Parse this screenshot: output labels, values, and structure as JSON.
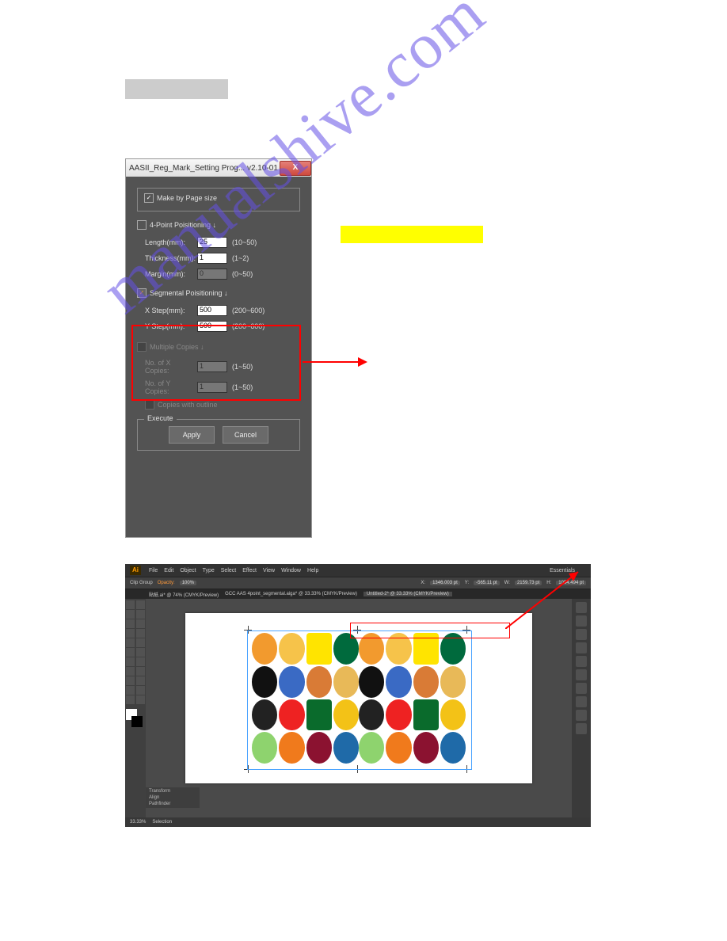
{
  "watermark": "manualshive.com",
  "dialog": {
    "title": "AASII_Reg_Mark_Setting Prog... v2.10-01",
    "close_glyph": "X",
    "make_by_page": "Make by Page size",
    "four_point": "4-Point Poisitioning ↓",
    "length": {
      "label": "Length(mm):",
      "value": "25",
      "range": "(10~50)"
    },
    "thickness": {
      "label": "Thickness(mm):",
      "value": "1",
      "range": "(1~2)"
    },
    "margin": {
      "label": "Margin(mm):",
      "value": "0",
      "range": "(0~50)"
    },
    "segmental": "Segmental Poisitioning ↓",
    "xstep": {
      "label": "X Step(mm):",
      "value": "500",
      "range": "(200~600)"
    },
    "ystep": {
      "label": "Y Step(mm):",
      "value": "500",
      "range": "(200~600)"
    },
    "multiple_copies": "Multiple Copies ↓",
    "xcopies": {
      "label": "No. of X Copies:",
      "value": "1",
      "range": "(1~50)"
    },
    "ycopies": {
      "label": "No. of Y Copies:",
      "value": "1",
      "range": "(1~50)"
    },
    "copies_outline": "Copies with outline",
    "execute_label": "Execute",
    "apply": "Apply",
    "cancel": "Cancel"
  },
  "ai": {
    "logo": "Ai",
    "menus": [
      "File",
      "Edit",
      "Object",
      "Type",
      "Select",
      "Effect",
      "View",
      "Window",
      "Help"
    ],
    "essentials": "Essentials",
    "optbar": {
      "clipgroup": "Clip Group",
      "opacity_lbl": "Opacity:",
      "opacity_val": "100%",
      "x": "X:",
      "xv": "1346.003 pt",
      "y": "Y:",
      "yv": "-565.11 pt",
      "w": "W:",
      "wv": "2159.73 pt",
      "h": "H:",
      "hv": "1054.494 pt"
    },
    "tabs": [
      "貼紙.ai* @ 74% (CMYK/Preview)",
      "GCC AAS 4point_segmental.aiga* @ 33.33% (CMYK/Preview)",
      "Untitled-2* @ 33.33% (CMYK/Preview)"
    ],
    "panels": [
      "Transform",
      "Align",
      "Pathfinder"
    ],
    "status_zoom": "33.33%",
    "status_sel": "Selection"
  }
}
